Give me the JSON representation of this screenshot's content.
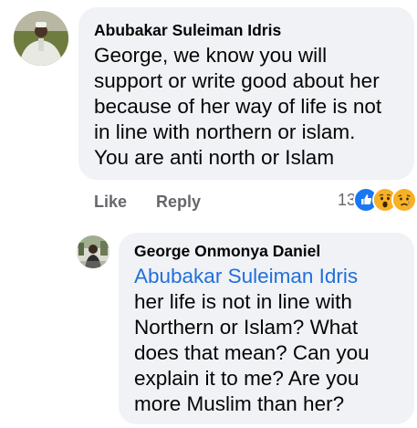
{
  "comment": {
    "author": "Abubakar Suleiman Idris",
    "lines": [
      "George, we know you will",
      "support or write good about her",
      "because of her way of life is not",
      "in line with northern or islam.",
      "You are anti north or Islam"
    ],
    "actions": {
      "like_label": "Like",
      "reply_label": "Reply"
    },
    "reactions": {
      "count": "13",
      "types": [
        "like-icon",
        "wow-icon",
        "sad-icon"
      ]
    }
  },
  "reply": {
    "author": "George Onmonya Daniel",
    "mention": "Abubakar Suleiman Idris",
    "lines": [
      "her life is not in line with",
      "Northern or Islam? What",
      "does that mean? Can you",
      "explain it to me? Are you",
      "more Muslim than her?"
    ]
  },
  "colors": {
    "bubble_bg": "#f0f2f5",
    "mention": "#216fdb",
    "meta_gray": "#65676b",
    "like_blue": "#1877f2",
    "emoji_yellow": "#f7b125"
  }
}
